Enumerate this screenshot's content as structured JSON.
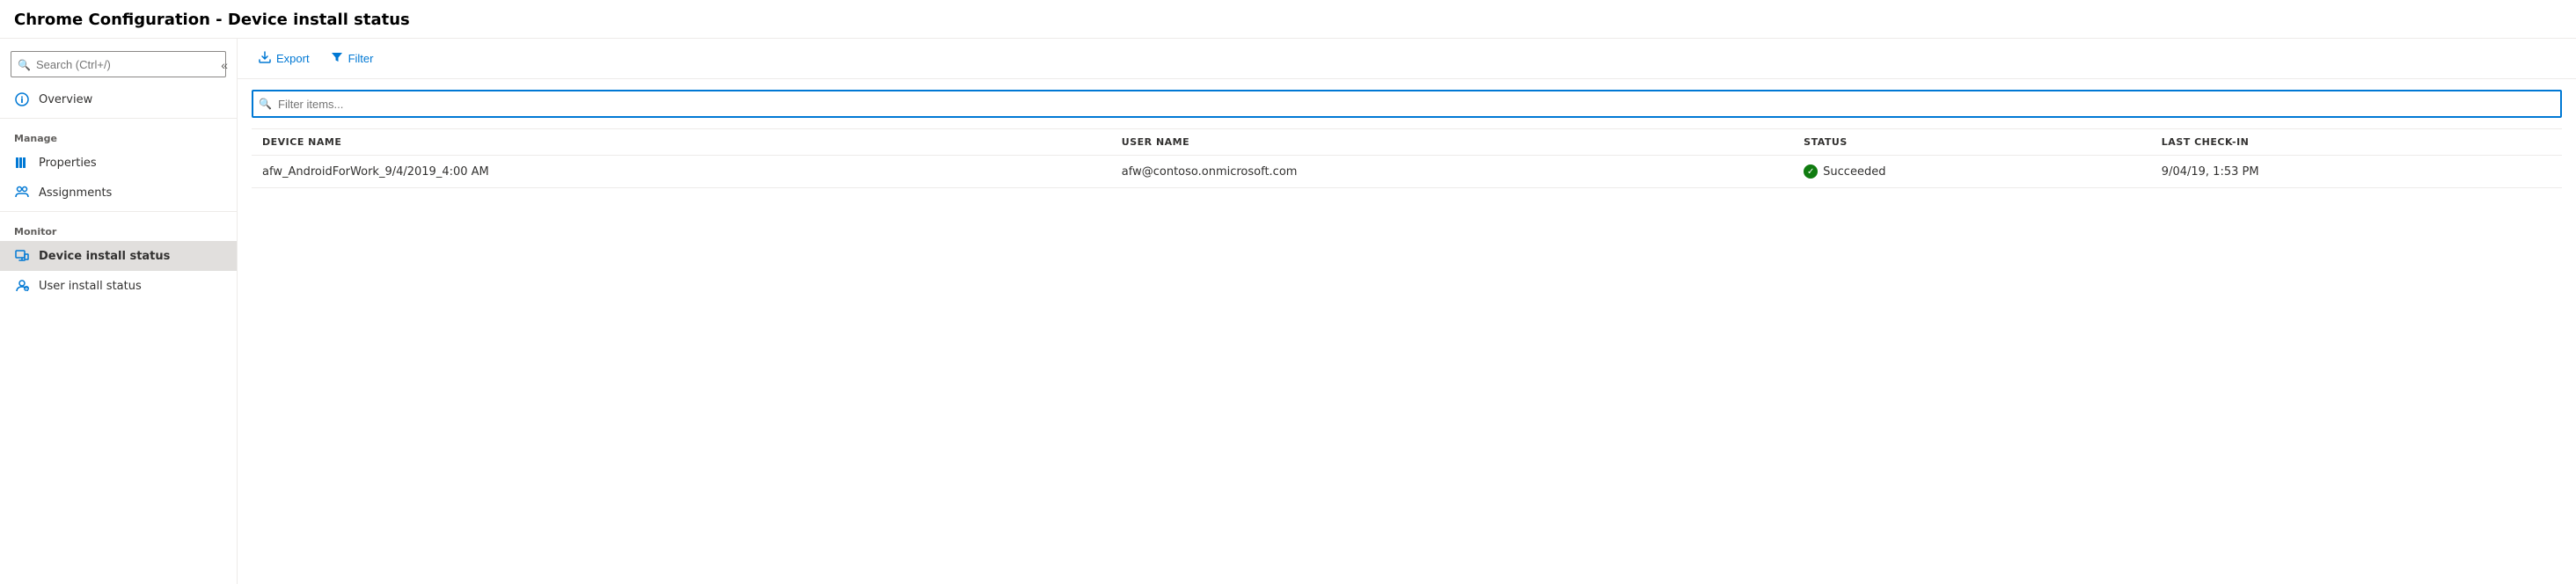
{
  "title": "Chrome Configuration - Device install status",
  "sidebar": {
    "search_placeholder": "Search (Ctrl+/)",
    "collapse_label": "«",
    "nav_items": [
      {
        "id": "overview",
        "label": "Overview",
        "icon": "info-icon",
        "section": null,
        "active": false
      }
    ],
    "manage_section": "Manage",
    "manage_items": [
      {
        "id": "properties",
        "label": "Properties",
        "icon": "properties-icon",
        "active": false
      },
      {
        "id": "assignments",
        "label": "Assignments",
        "icon": "assignments-icon",
        "active": false
      }
    ],
    "monitor_section": "Monitor",
    "monitor_items": [
      {
        "id": "device-install-status",
        "label": "Device install status",
        "icon": "device-icon",
        "active": true
      },
      {
        "id": "user-install-status",
        "label": "User install status",
        "icon": "user-icon",
        "active": false
      }
    ]
  },
  "toolbar": {
    "export_label": "Export",
    "filter_label": "Filter"
  },
  "table": {
    "filter_placeholder": "Filter items...",
    "columns": [
      {
        "id": "device_name",
        "label": "DEVICE NAME"
      },
      {
        "id": "user_name",
        "label": "USER NAME"
      },
      {
        "id": "status",
        "label": "STATUS"
      },
      {
        "id": "last_checkin",
        "label": "LAST CHECK-IN"
      }
    ],
    "rows": [
      {
        "device_name": "afw_AndroidForWork_9/4/2019_4:00 AM",
        "user_name": "afw@contoso.onmicrosoft.com",
        "status": "Succeeded",
        "status_type": "success",
        "last_checkin": "9/04/19, 1:53 PM"
      }
    ]
  }
}
